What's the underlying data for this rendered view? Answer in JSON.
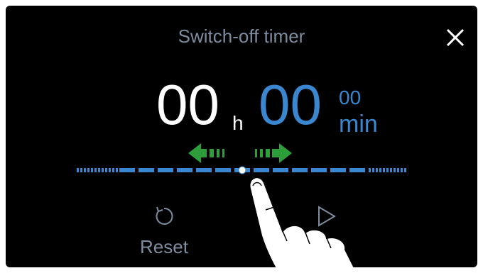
{
  "header": {
    "title": "Switch-off timer",
    "close_icon": "close-icon"
  },
  "timer": {
    "hours": "00",
    "hours_unit": "h",
    "minutes": "00",
    "seconds": "00",
    "minutes_unit": "min"
  },
  "slider": {
    "value": 0.5,
    "icon_left": "swipe-left-arrow-icon",
    "icon_right": "swipe-right-arrow-icon"
  },
  "controls": {
    "reset_label": "Reset",
    "reset_icon": "reset-icon",
    "start_icon": "play-icon"
  },
  "colors": {
    "background": "#000000",
    "accent": "#3a86cf",
    "muted_text": "#7d8c9e",
    "arrow": "#2e9e3a"
  }
}
